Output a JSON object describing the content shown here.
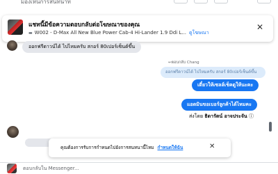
{
  "header": {
    "status_text": "มองเห็นการสนทนาที่"
  },
  "banner": {
    "title": "แชทนี้มีข้อความตอบกลับต่อโฆษณาของคุณ",
    "product": "W002 - D-Max All New Blue Power Cab-4 Hi-Lander 1.9 Ddi L...",
    "link": "ดูโฆษณา",
    "car_icon": "car-icon",
    "close_icon": "close-icon"
  },
  "messages": {
    "incoming_1": "ออกฟรีดาวน์ได้ ไปไหมครับ สกอร์ 80เปอร์เซ็นต์ขึ้น",
    "reply_header": "↩ตอบกลับ Chang",
    "quoted": "ออกฟรีดาวน์ได้ ไปไหมครับ สกอร์ 80เปอร์เซ็นต์ขึ้น",
    "outgoing_1": "เดี๋ยวให้เซลล์เช็คดูให้นะคะ",
    "outgoing_2": "แอดมินขอเบอร์ลูกค้าได้ไหมคะ",
    "sent_by_prefix": "ส่งโดย",
    "sent_by_name": "ธิดารัตน์ อาจประจัน",
    "sent_by_suffix": "ⓘ"
  },
  "notice": {
    "text": "คุณต้องการรับการกำหนดไปยังการสนทนานี้ไหม",
    "link": "กำหนดให้ฉัน",
    "close_icon": "close-icon"
  },
  "composer": {
    "placeholder": "ตอบกลับใน Messenger..."
  },
  "colors": {
    "accent": "#1877f2",
    "incoming_bubble": "#e4e6eb",
    "quoted_bubble": "#dcebfb"
  }
}
